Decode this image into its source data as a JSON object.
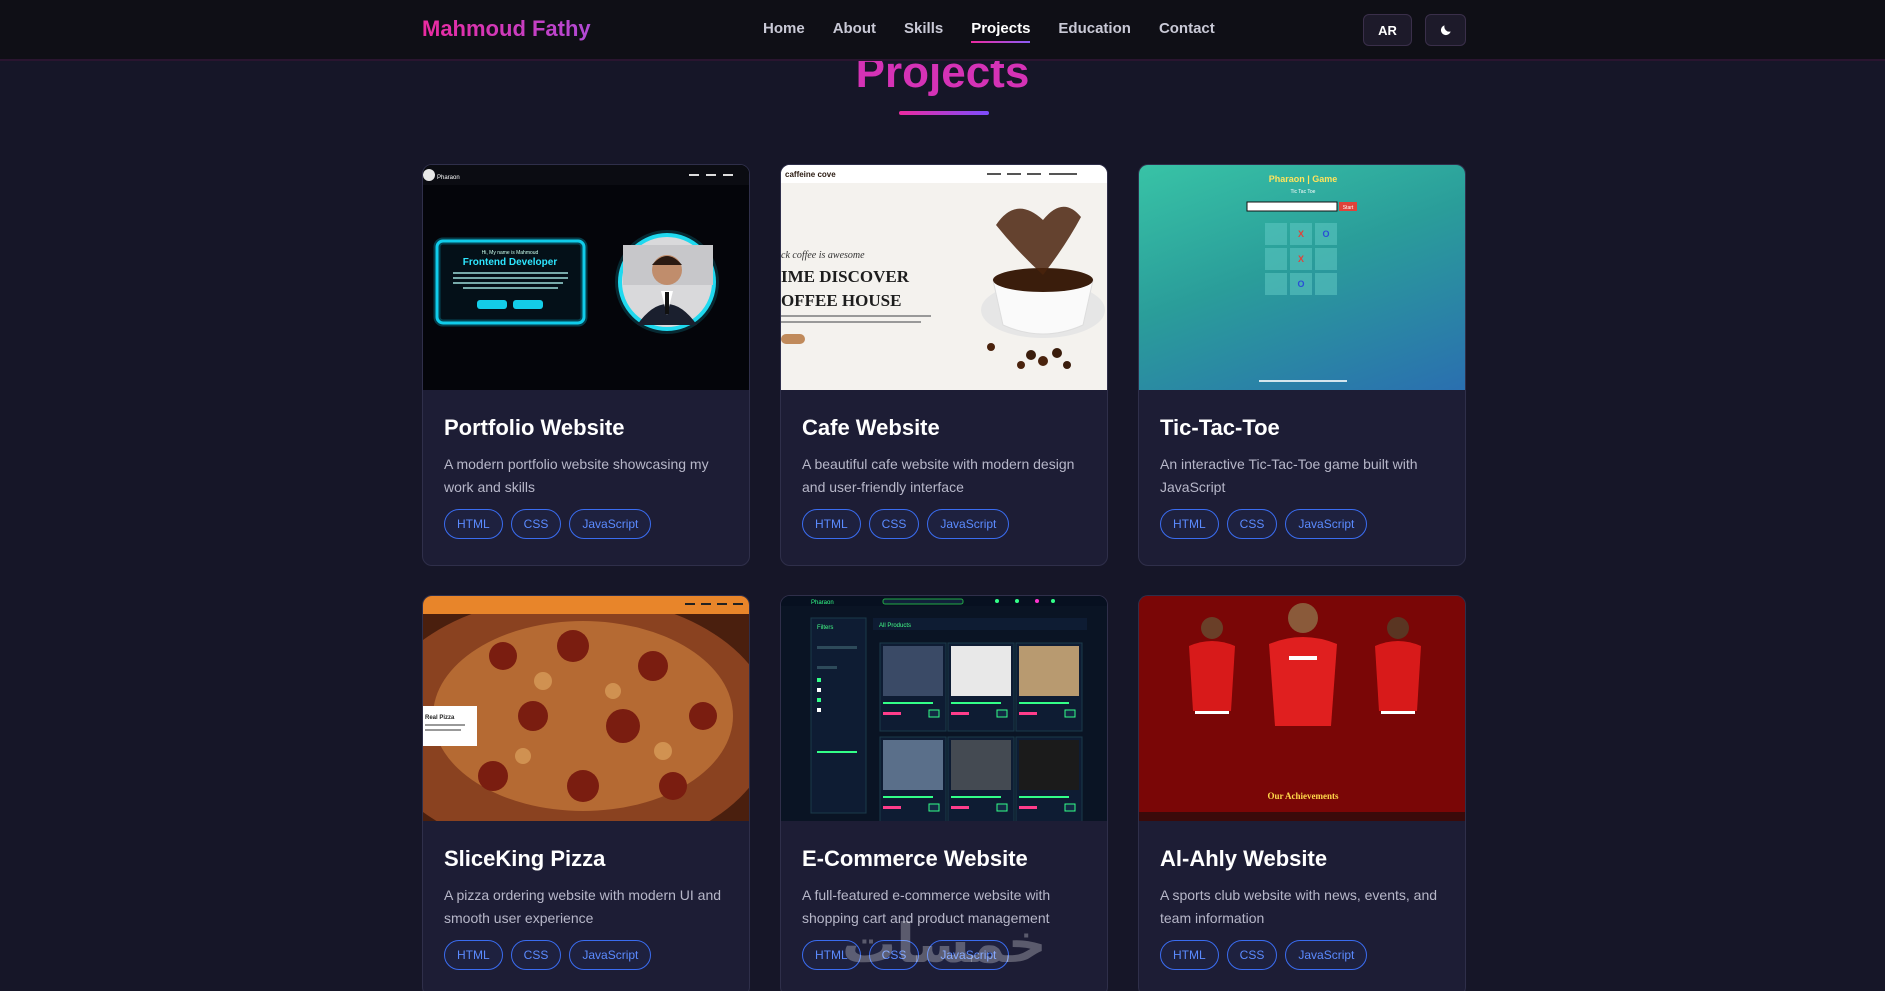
{
  "nav": {
    "brand": "Mahmoud Fathy",
    "links": [
      "Home",
      "About",
      "Skills",
      "Projects",
      "Education",
      "Contact"
    ],
    "active": "Projects",
    "lang_label": "AR",
    "theme_icon": "moon-icon"
  },
  "section": {
    "title": "Projects"
  },
  "colors": {
    "accent_pink": "#ec2aa0",
    "accent_purple": "#8b5cf6",
    "tag_blue": "#3a6cf0",
    "bg": "#161628",
    "card": "#1d1d35"
  },
  "projects": [
    {
      "title": "Portfolio Website",
      "description": "A modern portfolio website showcasing my work and skills",
      "tags": [
        "HTML",
        "CSS",
        "JavaScript"
      ],
      "preview": {
        "brand": "Pharaon",
        "heading": "Frontend Developer",
        "intro": "Hi, My name is Mahmoud"
      }
    },
    {
      "title": "Cafe Website",
      "description": "A beautiful cafe website with modern design and user-friendly interface",
      "tags": [
        "HTML",
        "CSS",
        "JavaScript"
      ],
      "preview": {
        "brand": "caffeine cove",
        "tagline": "ck coffee is awesome",
        "line1": "IME DISCOVER",
        "line2": "OFFEE HOUSE"
      }
    },
    {
      "title": "Tic-Tac-Toe",
      "description": "An interactive Tic-Tac-Toe game built with JavaScript",
      "tags": [
        "HTML",
        "CSS",
        "JavaScript"
      ],
      "preview": {
        "heading": "Pharaon | Game",
        "sub": "Tic Tac Toe",
        "button": "Start",
        "board": [
          "",
          "X",
          "O",
          "",
          "X",
          "",
          "",
          "O",
          ""
        ]
      }
    },
    {
      "title": "SliceKing Pizza",
      "description": "A pizza ordering website with modern UI and smooth user experience",
      "tags": [
        "HTML",
        "CSS",
        "JavaScript"
      ],
      "preview": {
        "badge": "Real Pizza"
      }
    },
    {
      "title": "E-Commerce Website",
      "description": "A full-featured e-commerce website with shopping cart and product management",
      "tags": [
        "HTML",
        "CSS",
        "JavaScript"
      ],
      "preview": {
        "brand": "Pharaon",
        "heading": "All Products",
        "filters": "Filters"
      }
    },
    {
      "title": "Al-Ahly Website",
      "description": "A sports club website with news, events, and team information",
      "tags": [
        "HTML",
        "CSS",
        "JavaScript"
      ],
      "preview": {
        "caption": "Our Achievements"
      }
    }
  ],
  "watermark": "خمسات"
}
